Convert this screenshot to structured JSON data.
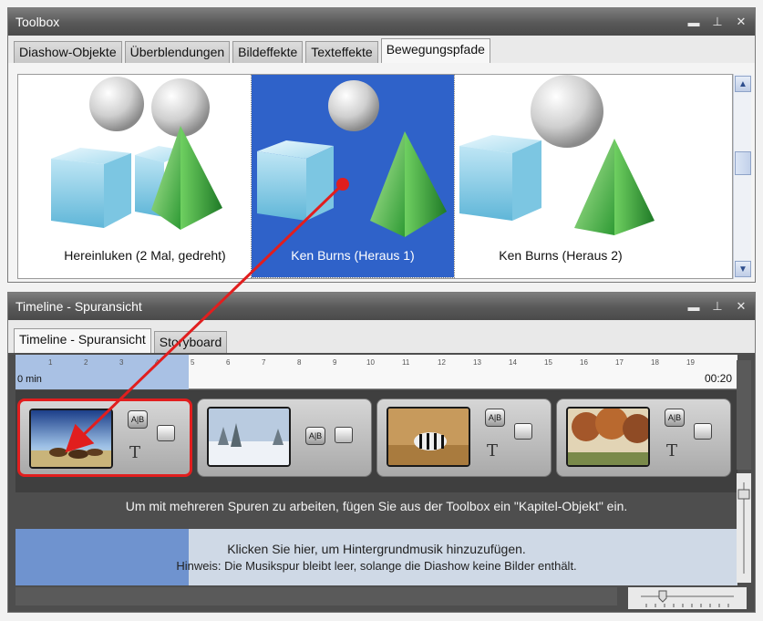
{
  "toolbox": {
    "title": "Toolbox",
    "controls": [
      "▬",
      "⊥",
      "✕"
    ],
    "tabs": [
      "Diashow-Objekte",
      "Überblendungen",
      "Bildeffekte",
      "Texteffekte",
      "Bewegungspfade"
    ],
    "active_tab": "Bewegungspfade",
    "items": [
      {
        "label": "Hereinluken (2 Mal, gedreht)"
      },
      {
        "label": "Ken Burns (Heraus 1)",
        "selected": true
      },
      {
        "label": "Ken Burns (Heraus 2)"
      }
    ]
  },
  "timeline": {
    "title": "Timeline - Spuransicht",
    "controls": [
      "▬",
      "⊥",
      "✕"
    ],
    "tabs": [
      "Timeline - Spuransicht",
      "Storyboard"
    ],
    "ruler": {
      "start": "0 min",
      "end": "00:20",
      "ticks": [
        "1",
        "2",
        "3",
        "4",
        "5",
        "6",
        "7",
        "8",
        "9",
        "10",
        "11",
        "12",
        "13",
        "14",
        "15",
        "16",
        "17",
        "18",
        "19"
      ]
    },
    "chapter_hint": "Um mit mehreren Spuren zu arbeiten, fügen Sie aus der Toolbox ein \"Kapitel-Objekt\" ein.",
    "music_line1": "Klicken Sie hier, um Hintergrundmusik hinzuzufügen.",
    "music_line2": "Hinweis: Die Musikspur bleibt leer, solange die Diashow keine Bilder enthält.",
    "slides": [
      {
        "subject": "horses"
      },
      {
        "subject": "winter"
      },
      {
        "subject": "zebra"
      },
      {
        "subject": "trees"
      }
    ]
  },
  "colors": {
    "selection": "#2f62c9",
    "arrow": "#e11e1e",
    "titlebar": "#585858"
  }
}
